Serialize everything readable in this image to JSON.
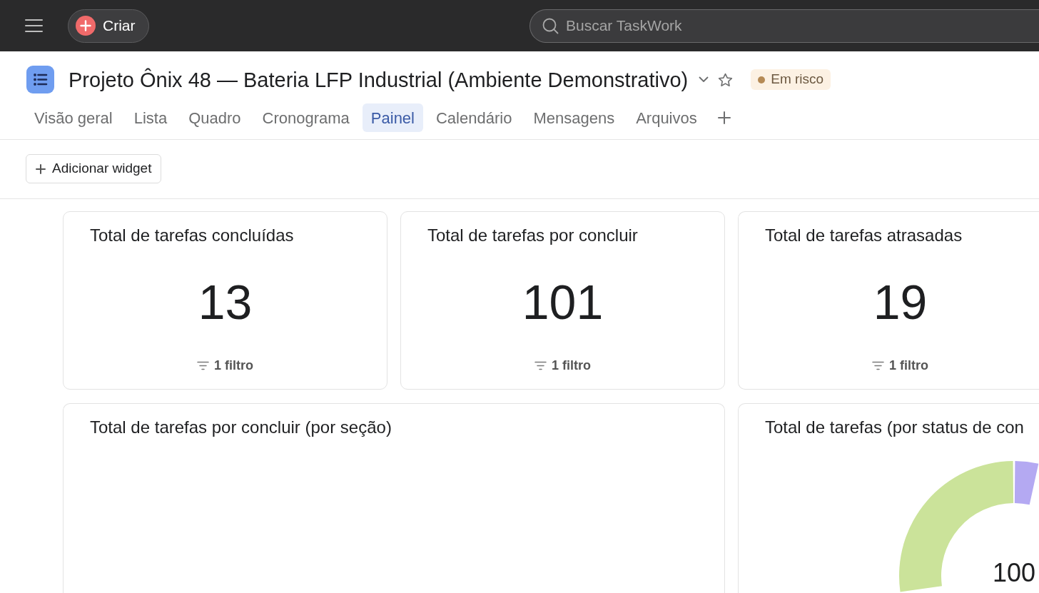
{
  "top_bar": {
    "create_button": {
      "label": "Criar"
    },
    "search": {
      "placeholder": "Buscar TaskWork"
    }
  },
  "project": {
    "title": "Projeto Ônix 48 — Bateria LFP Industrial (Ambiente Demonstrativo)",
    "status": {
      "label": "Em risco"
    }
  },
  "tabs": [
    {
      "label": "Visão geral",
      "selected": false
    },
    {
      "label": "Lista",
      "selected": false
    },
    {
      "label": "Quadro",
      "selected": false
    },
    {
      "label": "Cronograma",
      "selected": false
    },
    {
      "label": "Painel",
      "selected": true
    },
    {
      "label": "Calendário",
      "selected": false
    },
    {
      "label": "Mensagens",
      "selected": false
    },
    {
      "label": "Arquivos",
      "selected": false
    }
  ],
  "toolbar": {
    "add_widget_button": "Adicionar widget"
  },
  "widgets": [
    {
      "kind": "metric",
      "title": "Total de tarefas concluídas",
      "value": "13",
      "filter": "1 filtro"
    },
    {
      "kind": "metric",
      "title": "Total de tarefas por concluir",
      "value": "101",
      "filter": "1 filtro"
    },
    {
      "kind": "metric",
      "title": "Total de tarefas atrasadas",
      "value": "19",
      "filter": "1 filtro"
    },
    {
      "kind": "blank",
      "title": "Total de tarefas por concluir (por seção)"
    },
    {
      "kind": "donut",
      "title": "Total de tarefas (por status de con",
      "center": "100"
    }
  ]
}
